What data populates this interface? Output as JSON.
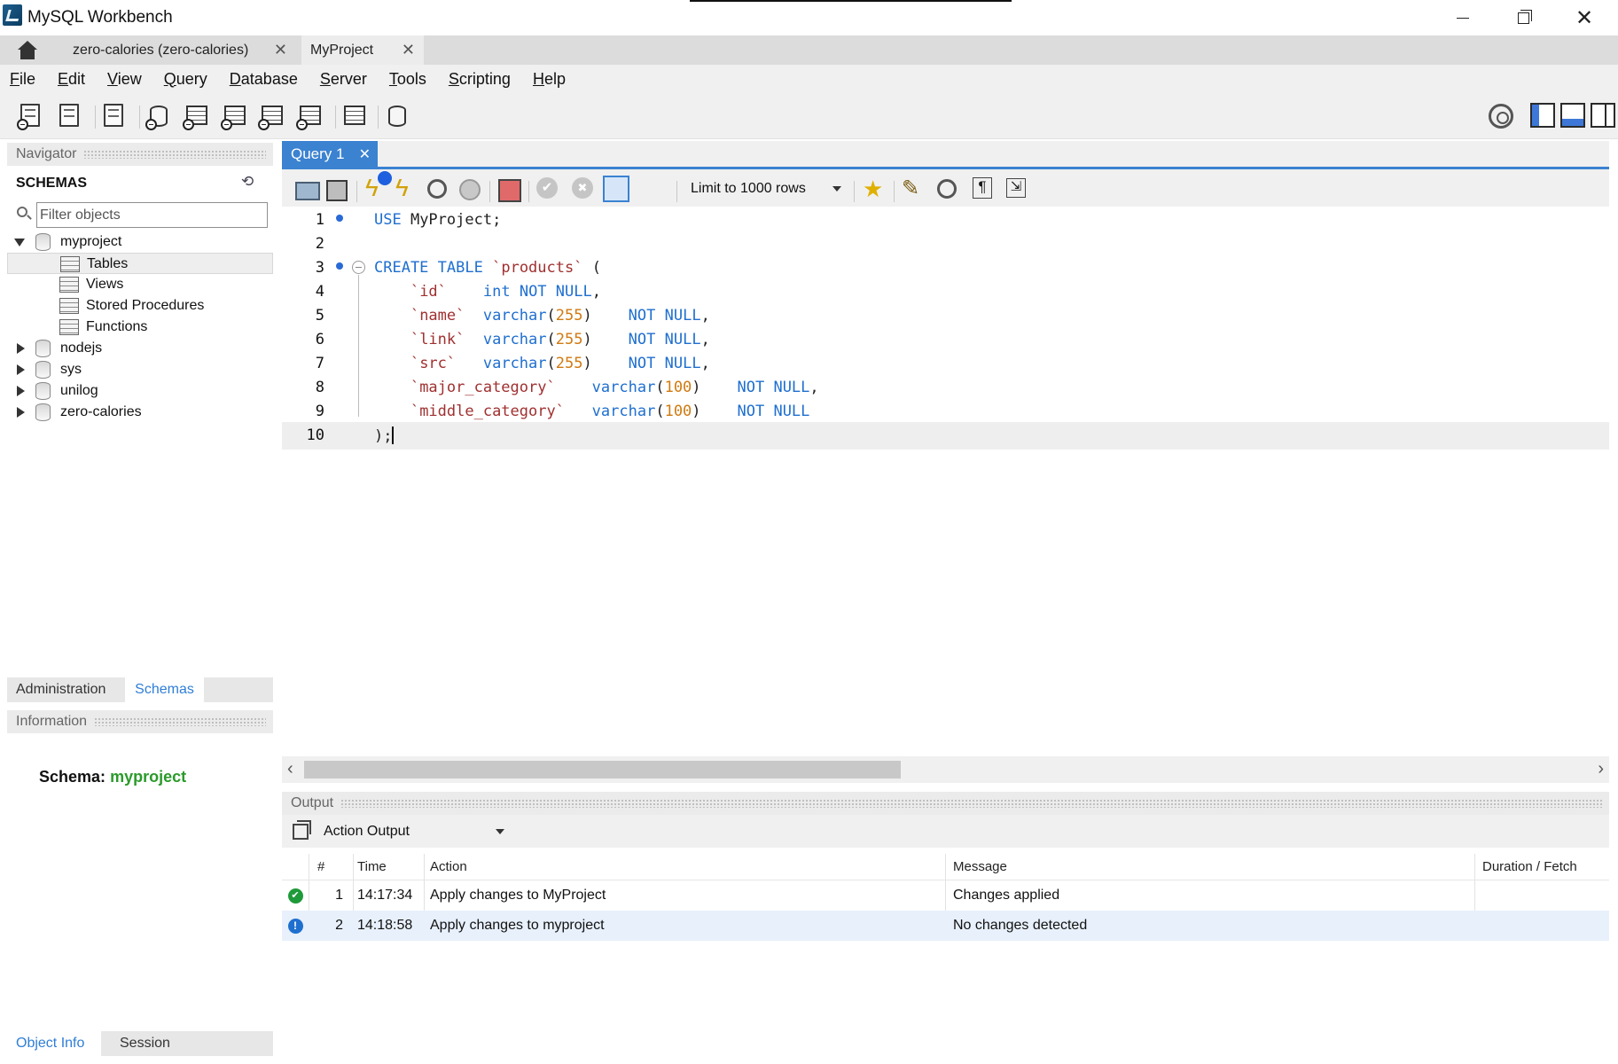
{
  "window": {
    "title": "MySQL Workbench"
  },
  "connection_tabs": [
    {
      "label": "zero-calories (zero-calories)"
    },
    {
      "label": "MyProject"
    }
  ],
  "menu": [
    {
      "prefix": "",
      "key": "F",
      "rest": "ile"
    },
    {
      "prefix": "",
      "key": "E",
      "rest": "dit"
    },
    {
      "prefix": "",
      "key": "V",
      "rest": "iew"
    },
    {
      "prefix": "",
      "key": "Q",
      "rest": "uery"
    },
    {
      "prefix": "",
      "key": "D",
      "rest": "atabase"
    },
    {
      "prefix": "",
      "key": "S",
      "rest": "erver"
    },
    {
      "prefix": "",
      "key": "T",
      "rest": "ools"
    },
    {
      "prefix": "",
      "key": "S",
      "rest": "cripting"
    },
    {
      "prefix": "",
      "key": "H",
      "rest": "elp"
    }
  ],
  "navigator": {
    "header": "Navigator",
    "schemas_title": "SCHEMAS",
    "filter_placeholder": "Filter objects",
    "schemas": [
      {
        "name": "myproject",
        "expanded": true,
        "children": [
          "Tables",
          "Views",
          "Stored Procedures",
          "Functions"
        ]
      },
      {
        "name": "nodejs",
        "expanded": false
      },
      {
        "name": "sys",
        "expanded": false
      },
      {
        "name": "unilog",
        "expanded": false
      },
      {
        "name": "zero-calories",
        "expanded": false
      }
    ],
    "tabs": {
      "admin": "Administration",
      "schemas": "Schemas"
    }
  },
  "information": {
    "header": "Information",
    "schema_label": "Schema:",
    "schema_value": "myproject",
    "tabs": {
      "object_info": "Object Info",
      "session": "Session"
    }
  },
  "editor": {
    "tab_label": "Query 1",
    "limit_label": "Limit to 1000 rows",
    "lines": [
      {
        "n": "1",
        "text": "USE MyProject;"
      },
      {
        "n": "2",
        "text": ""
      },
      {
        "n": "3",
        "text": "CREATE TABLE `products` ("
      },
      {
        "n": "4",
        "text": "    `id`    int NOT NULL,"
      },
      {
        "n": "5",
        "text": "    `name`  varchar(255)    NOT NULL,"
      },
      {
        "n": "6",
        "text": "    `link`  varchar(255)    NOT NULL,"
      },
      {
        "n": "7",
        "text": "    `src`   varchar(255)    NOT NULL,"
      },
      {
        "n": "8",
        "text": "    `major_category`    varchar(100)    NOT NULL,"
      },
      {
        "n": "9",
        "text": "    `middle_category`   varchar(100)    NOT NULL"
      },
      {
        "n": "10",
        "text": ");"
      }
    ]
  },
  "output": {
    "header": "Output",
    "selector": "Action Output",
    "columns": {
      "num": "#",
      "time": "Time",
      "action": "Action",
      "message": "Message",
      "duration": "Duration / Fetch"
    },
    "rows": [
      {
        "status": "ok",
        "num": "1",
        "time": "14:17:34",
        "action": "Apply changes to MyProject",
        "message": "Changes applied",
        "duration": ""
      },
      {
        "status": "info",
        "num": "2",
        "time": "14:18:58",
        "action": "Apply changes to myproject",
        "message": "No changes detected",
        "duration": ""
      }
    ]
  },
  "colors": {
    "accent": "#3b82d1",
    "schema_value": "#2a9a2a",
    "sql_keyword": "#1f6fcf",
    "sql_identifier": "#a03030",
    "sql_number": "#d07a10"
  }
}
